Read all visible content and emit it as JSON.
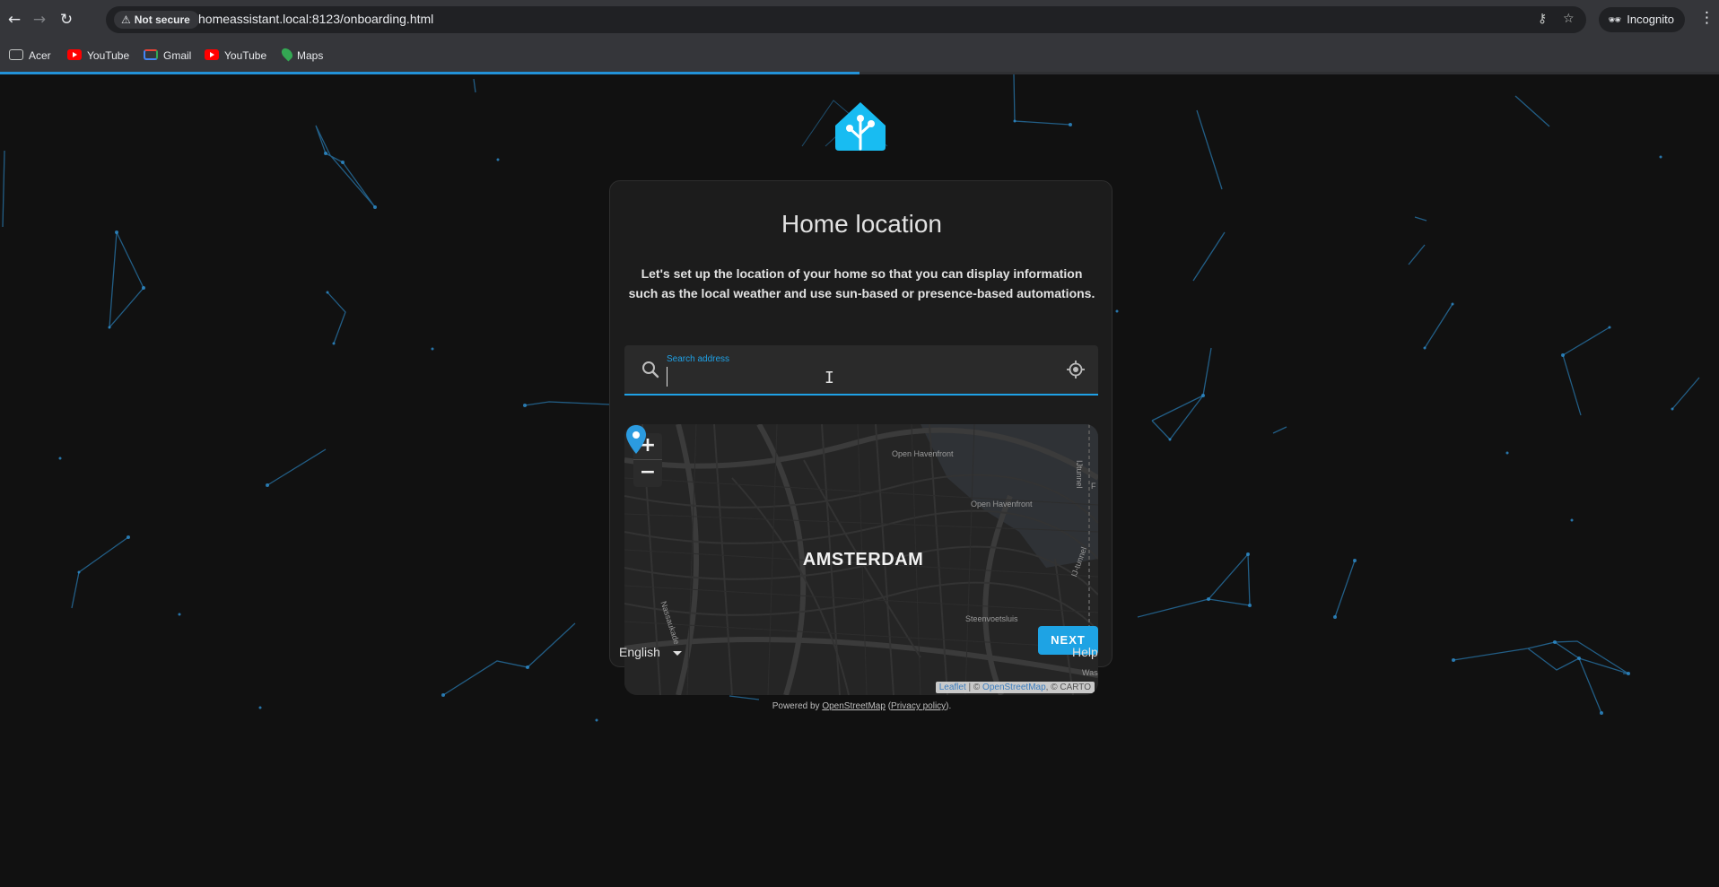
{
  "browser": {
    "back_icon": "←",
    "forward_icon": "→",
    "reload_icon": "↻",
    "security_label": "Not secure",
    "warning_icon": "⚠",
    "url": "homeassistant.local:8123/onboarding.html",
    "key_icon": "⚷",
    "star_icon": "☆",
    "incognito_label": "Incognito",
    "incognito_icon": "🕶",
    "menu_icon": "⋮",
    "load_progress_fraction": 0.5,
    "bookmarks": [
      {
        "label": "Acer",
        "icon": "folder-icon"
      },
      {
        "label": "YouTube",
        "icon": "youtube-icon"
      },
      {
        "label": "Gmail",
        "icon": "gmail-icon"
      },
      {
        "label": "YouTube",
        "icon": "youtube-icon"
      },
      {
        "label": "Maps",
        "icon": "maps-icon"
      }
    ]
  },
  "onboarding": {
    "title": "Home location",
    "description": "Let's set up the location of your home so that you can display information such as the local weather and use sun-based or presence-based automations.",
    "search": {
      "label": "Search address",
      "value": ""
    },
    "map": {
      "city": "AMSTERDAM",
      "zoom_in": "+",
      "zoom_out": "−",
      "streets": [
        "Open Havenfront",
        "Open Havenfront",
        "Nassaukade",
        "Steenvoetsluis",
        "IJ-tunnel",
        "IJtunnel",
        "Was",
        "F"
      ],
      "attribution": {
        "leaflet": "Leaflet",
        "sep": " | © ",
        "osm": "OpenStreetMap",
        "carto": ", © CARTO"
      }
    },
    "powered_by": {
      "prefix": "Powered by ",
      "osm": "OpenStreetMap",
      "mid": " (",
      "privacy": "Privacy policy",
      "suffix": ")."
    },
    "next_label": "NEXT",
    "language": "English",
    "help": "Help"
  },
  "colors": {
    "accent": "#1ea3e4",
    "page_bg": "#111111",
    "card_bg": "#1c1c1c"
  }
}
